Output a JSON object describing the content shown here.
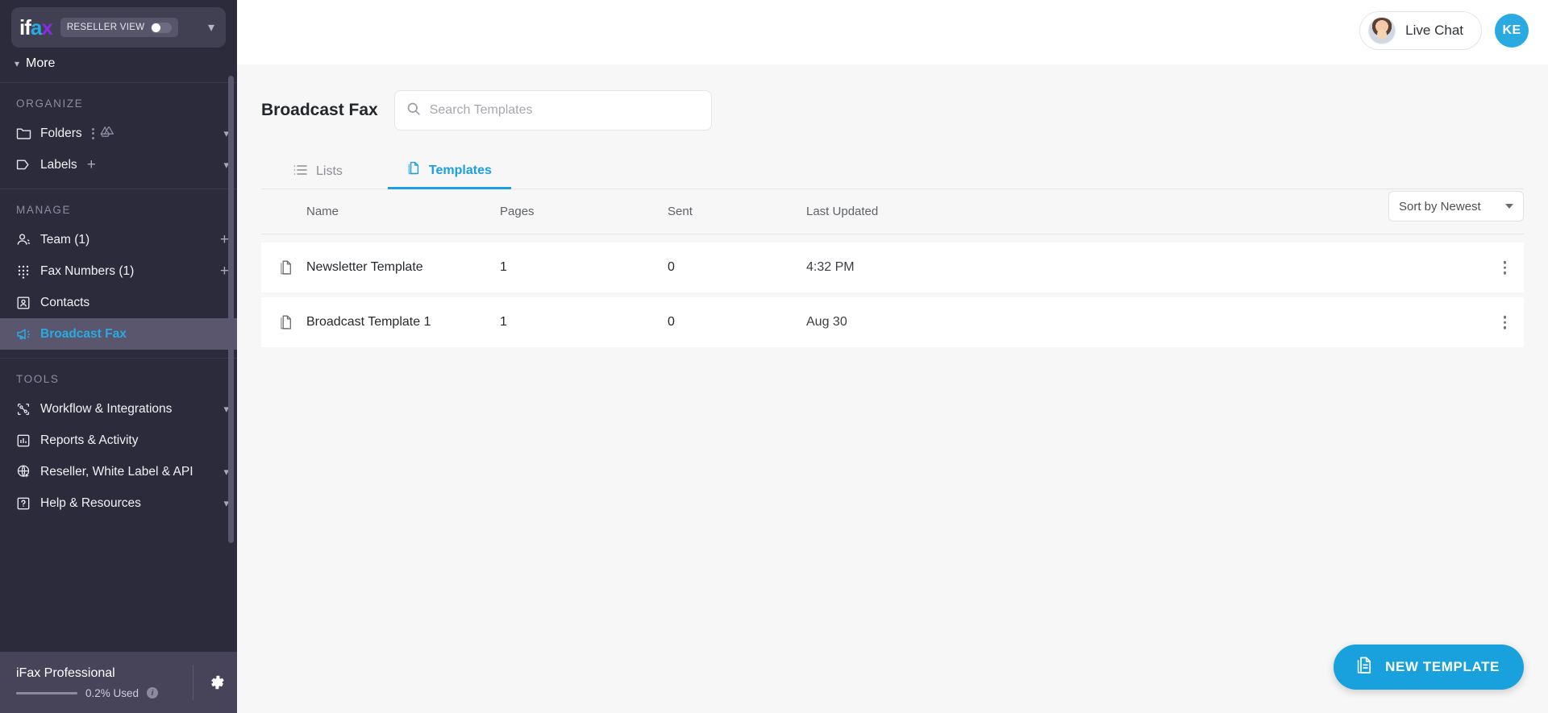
{
  "topbar": {
    "live_chat_label": "Live Chat",
    "avatar_initials": "KE"
  },
  "sidebar": {
    "brand": {
      "text_i": "if",
      "text_a": "a",
      "text_x": "x"
    },
    "reseller_toggle_label": "RESELLER VIEW",
    "partial_item_label": "More",
    "sections": [
      {
        "title": "ORGANIZE",
        "items": [
          {
            "label": "Folders",
            "icon": "folder-icon",
            "has_dots": true,
            "has_drive": true,
            "has_chevron": true
          },
          {
            "label": "Labels",
            "icon": "label-tag-icon",
            "has_plus": true,
            "has_chevron": true
          }
        ]
      },
      {
        "title": "MANAGE",
        "items": [
          {
            "label": "Team (1)",
            "icon": "people-icon",
            "has_plus": true
          },
          {
            "label": "Fax Numbers (1)",
            "icon": "keypad-icon",
            "has_plus": true
          },
          {
            "label": "Contacts",
            "icon": "contact-card-icon"
          },
          {
            "label": "Broadcast Fax",
            "icon": "megaphone-icon",
            "active": true
          }
        ]
      },
      {
        "title": "TOOLS",
        "items": [
          {
            "label": "Workflow & Integrations",
            "icon": "workflow-icon",
            "has_chevron": true
          },
          {
            "label": "Reports & Activity",
            "icon": "bar-chart-icon"
          },
          {
            "label": "Reseller, White Label & API",
            "icon": "globe-icon",
            "has_chevron": true
          },
          {
            "label": "Help & Resources",
            "icon": "question-box-icon",
            "has_chevron": true
          }
        ]
      }
    ],
    "footer": {
      "plan_name": "iFax Professional",
      "usage_label": "0.2% Used",
      "usage_percent": 0.2,
      "settings_icon": "gear-icon"
    }
  },
  "main": {
    "page_title": "Broadcast Fax",
    "search": {
      "placeholder": "Search Templates",
      "value": ""
    },
    "tabs": [
      {
        "label": "Lists",
        "icon": "list-icon",
        "active": false
      },
      {
        "label": "Templates",
        "icon": "document-icon",
        "active": true
      }
    ],
    "table": {
      "columns": [
        "Name",
        "Pages",
        "Sent",
        "Last Updated"
      ],
      "sort_label": "Sort by Newest",
      "rows": [
        {
          "name": "Newsletter Template",
          "pages": "1",
          "sent": "0",
          "last_updated": "4:32 PM"
        },
        {
          "name": "Broadcast Template 1",
          "pages": "1",
          "sent": "0",
          "last_updated": "Aug 30"
        }
      ]
    },
    "new_template_button": "NEW TEMPLATE"
  },
  "colors": {
    "accent": "#29abe2",
    "sidebar_bg": "#2b2b3c",
    "sidebar_active": "#5a566d",
    "fab": "#19a1dd"
  }
}
